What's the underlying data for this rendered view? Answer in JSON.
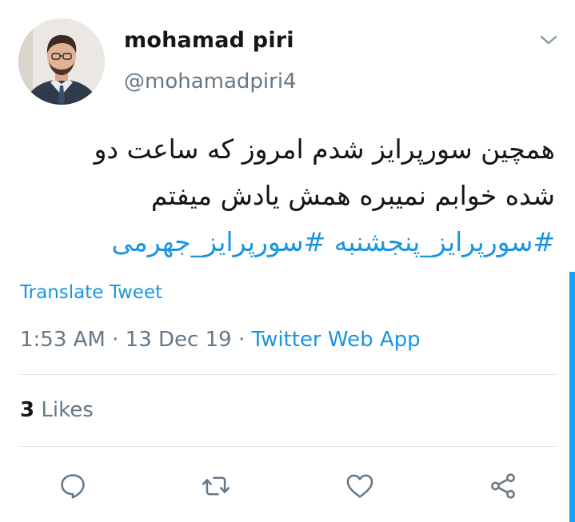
{
  "user": {
    "display_name": "mohamad piri",
    "handle": "@mohamadpiri4"
  },
  "tweet": {
    "text_lines": [
      "همچین سورپرایز شدم امروز که ساعت دو",
      "شده خوابم نمیبره همش یادش میفتم"
    ],
    "hashtags": "#سورپرایز_پنجشنبه #سورپرایز_جهرمی",
    "translate_label": "Translate Tweet",
    "time": "1:53 AM",
    "date": "13 Dec 19",
    "separator": "·",
    "source": "Twitter Web App"
  },
  "stats": {
    "likes_count": "3",
    "likes_label": "Likes"
  },
  "icons": {
    "menu": "chevron-down-icon",
    "reply": "reply-icon",
    "retweet": "retweet-icon",
    "like": "heart-icon",
    "share": "share-icon"
  },
  "colors": {
    "link": "#1b95e0",
    "muted": "#657786",
    "text": "#14171a",
    "divider": "#e1e8ed"
  }
}
